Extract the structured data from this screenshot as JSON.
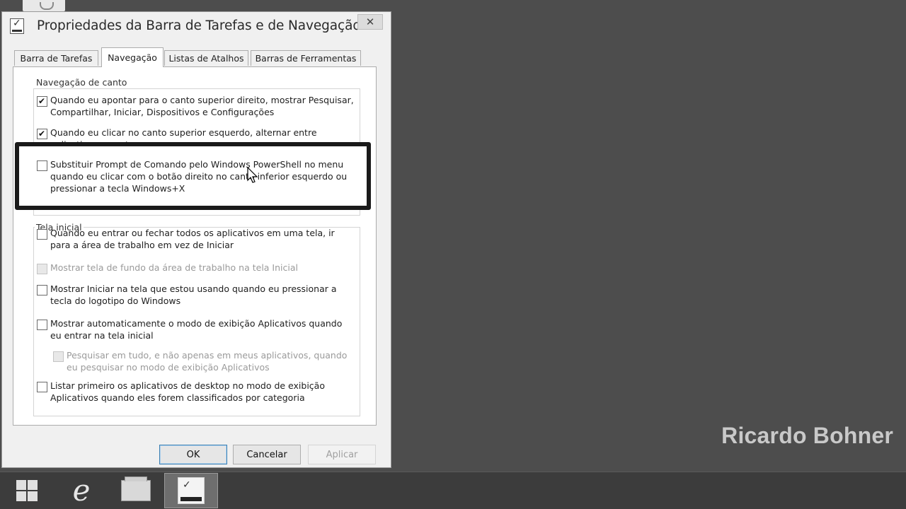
{
  "dialog": {
    "title": "Propriedades da Barra de Tarefas e de Navegação",
    "close_label": "✕",
    "tabs": [
      {
        "label": "Barra de Tarefas",
        "active": false
      },
      {
        "label": "Navegação",
        "active": true
      },
      {
        "label": "Listas de Atalhos",
        "active": false
      },
      {
        "label": "Barras de Ferramentas",
        "active": false
      }
    ],
    "corner_group": {
      "title": "Navegação de canto",
      "options": [
        {
          "text": "Quando eu apontar para o canto superior direito, mostrar Pesquisar, Compartilhar, Iniciar, Dispositivos e Configurações",
          "checked": true
        },
        {
          "text": "Quando eu clicar no canto superior esquerdo, alternar entre aplicativos recentes",
          "checked": true
        },
        {
          "text": "Substituir Prompt de Comando pelo Windows PowerShell no menu quando eu clicar com o botão direito no canto inferior esquerdo ou pressionar a tecla Windows+X",
          "checked": false
        }
      ]
    },
    "start_group": {
      "title": "Tela inicial",
      "options": [
        {
          "text": "Quando eu entrar ou fechar todos os aplicativos em uma tela, ir para a área de trabalho em vez de Iniciar",
          "checked": false,
          "disabled": false
        },
        {
          "text": "Mostrar tela de fundo da área de trabalho na tela Inicial",
          "checked": false,
          "disabled": true
        },
        {
          "text": "Mostrar Iniciar na tela que estou usando quando eu pressionar a tecla do logotipo do Windows",
          "checked": false,
          "disabled": false
        },
        {
          "text": "Mostrar automaticamente o modo de exibição Aplicativos quando eu entrar na tela inicial",
          "checked": false,
          "disabled": false
        },
        {
          "text": "Pesquisar em tudo, e não apenas em meus aplicativos, quando eu pesquisar no modo de exibição Aplicativos",
          "checked": false,
          "disabled": true
        },
        {
          "text": "Listar primeiro os aplicativos de desktop no modo de exibição Aplicativos quando eles forem classificados por categoria",
          "checked": false,
          "disabled": false
        }
      ]
    },
    "buttons": {
      "ok": "OK",
      "cancel": "Cancelar",
      "apply": "Aplicar"
    }
  },
  "watermark": "Ricardo Bohner",
  "taskbar": {
    "items": [
      {
        "icon": "windows-logo-icon"
      },
      {
        "icon": "internet-explorer-icon"
      },
      {
        "icon": "file-explorer-icon"
      },
      {
        "icon": "taskbar-properties-icon",
        "active": true
      }
    ]
  },
  "colors": {
    "desktop": "#4d4d4d",
    "taskbar": "#3c3c3c",
    "highlight_border": "#1a1a1a"
  }
}
